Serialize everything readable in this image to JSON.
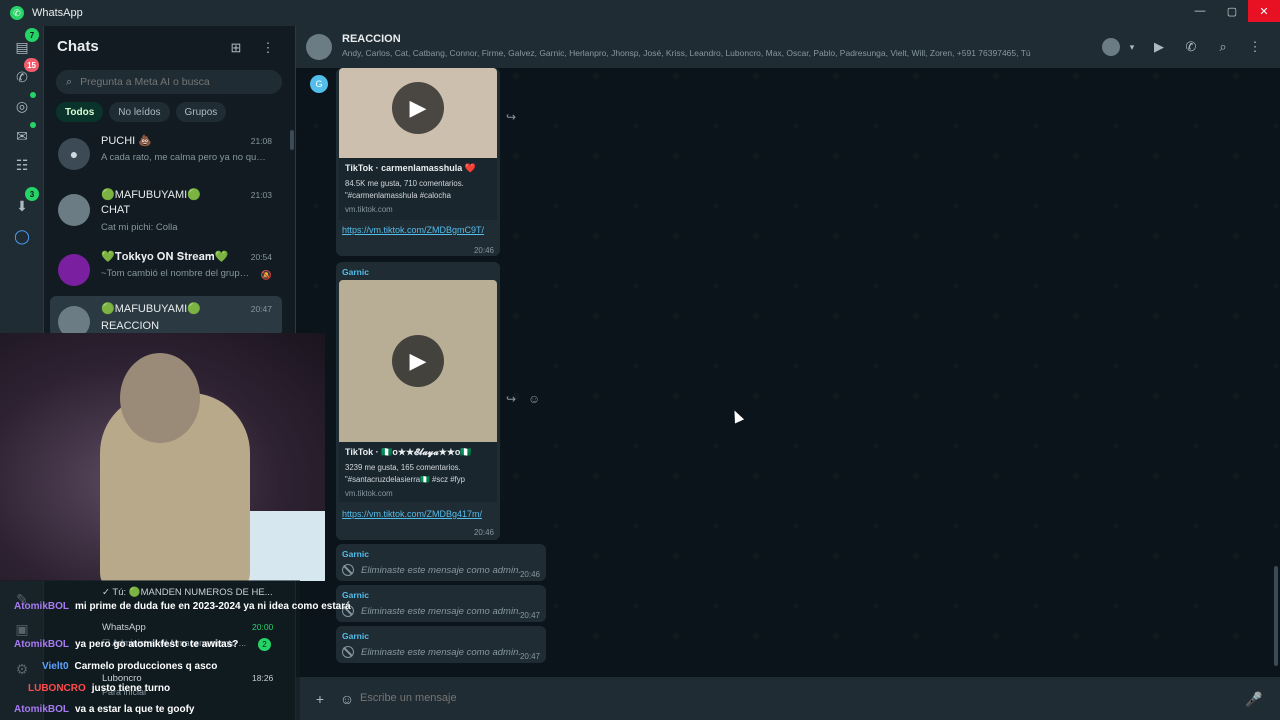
{
  "window": {
    "title": "WhatsApp",
    "minimize": "—",
    "maximize": "▢",
    "close": "✕"
  },
  "rail": {
    "chats_badge": "7",
    "calls_badge": "15",
    "archive_badge": "3"
  },
  "sidebar": {
    "title": "Chats",
    "search_placeholder": "Pregunta a Meta AI o busca",
    "filters": [
      "Todos",
      "No leídos",
      "Grupos"
    ],
    "chats": [
      {
        "name": "PUCHI 💩",
        "time": "21:08",
        "preview": "A cada rato, me calma pero ya no quie..."
      },
      {
        "name": "🟢MAFUBUYAMI🟢",
        "sub": "CHAT",
        "time": "21:03",
        "preview": "Cat mi pichi: Colla"
      },
      {
        "name": "💚𝐓𝐨𝐤𝐤𝐲𝐨 𝐎𝐍 𝐒𝐭𝐫𝐞𝐚𝐦💚",
        "time": "20:54",
        "preview": "~Tom cambió el nombre del grupo ..."
      },
      {
        "name": "🟢MAFUBUYAMI🟢",
        "sub": "REACCION",
        "time": "20:47"
      }
    ],
    "ghost_rows": {
      "row1": "✓ Tú: 🟢MANDEN NUMEROS DE HE...",
      "row2_name": "WhatsApp",
      "row2_time": "20:00",
      "row2_preview": "☐ Administrar el Almacenamiento ...",
      "row2_badge": "2",
      "row3_name": "Luboncro",
      "row3_time": "18:26",
      "row3_preview": "Para iniciar"
    }
  },
  "conversation": {
    "title": "REACCION",
    "members": "Andy, Carlos, Cat, Catbang, Connor, Firme, Galvez, Garnic, Herlanpro, Jhonsp, José, Kriss, Leandro, Luboncro, Max, Oscar, Pablo, Padresunga, Vielt, Will, Zoren, +591 76397465, Tú",
    "group_initial": "G",
    "messages": [
      {
        "link_title": "TikTok · carmenlamasshula ❤️",
        "link_desc": "84.5K me gusta, 710 comentarios. \"#carmenlamasshula #calocha",
        "link_domain": "vm.tiktok.com",
        "url": "https://vm.tiktok.com/ZMDBgmC9T/",
        "time": "20:46"
      },
      {
        "sender": "Garnic",
        "link_title": "TikTok · 🇳🇬ᴏ★★𝓔𝓵𝓪𝔂𝓪★★ᴏ🇳🇬",
        "link_desc": "3239 me gusta, 165 comentarios. \"#santacruzdelasierra🇳🇬 #scz #fyp",
        "link_domain": "vm.tiktok.com",
        "url": "https://vm.tiktok.com/ZMDBg417m/",
        "time": "20:46"
      },
      {
        "sender": "Garnic",
        "text": "Eliminaste este mensaje como admin.",
        "time": "20:46"
      },
      {
        "sender": "Garnic",
        "text": "Eliminaste este mensaje como admin.",
        "time": "20:47"
      },
      {
        "sender": "Garnic",
        "text": "Eliminaste este mensaje como admin.",
        "time": "20:47"
      }
    ],
    "composer_placeholder": "Escribe un mensaje"
  },
  "stream_chat": [
    {
      "user": "AtomikBOL",
      "msg": "mi prime de duda fue en 2023-2024 ya ni idea como estará"
    },
    {
      "user": "AtomikBOL",
      "msg": "ya pero go atomikfest o te awitas?"
    },
    {
      "user": "Vielt0",
      "msg": "Carmelo producciones q asco"
    },
    {
      "user": "LUBONCRO",
      "msg": "justo tiene turno"
    },
    {
      "user": "AtomikBOL",
      "msg": "va a estar la que te goofy"
    }
  ],
  "colors": {
    "accent": "#25d366",
    "link": "#53bdeb",
    "panel": "#202c33",
    "background": "#0b141a"
  }
}
